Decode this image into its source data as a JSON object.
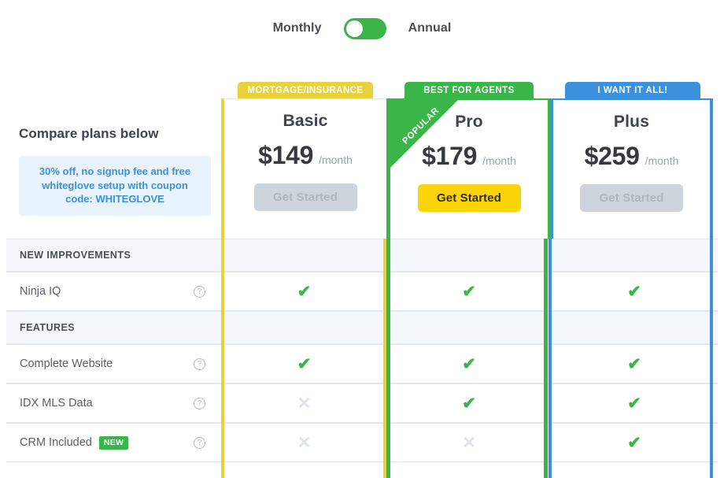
{
  "billing": {
    "monthly_label": "Monthly",
    "annual_label": "Annual",
    "selected": "Monthly",
    "toggle_color": "#3ab54a"
  },
  "intro": {
    "title": "Compare plans below",
    "coupon_text": "30% off, no signup fee and free whiteglove setup with coupon code: WHITEGLOVE",
    "coupon_bg": "#e8f3fd",
    "coupon_color": "#3b91dc"
  },
  "plans": [
    {
      "id": "basic",
      "banner": "MORTGAGE/INSURANCE",
      "banner_color": "#e8d13a",
      "accent": "#e8d13a",
      "name": "Basic",
      "price": "$149",
      "period": "/month",
      "cta_label": "Get Started",
      "cta_state": "disabled",
      "ribbon": null
    },
    {
      "id": "pro",
      "banner": "BEST FOR AGENTS",
      "banner_color": "#3ab54a",
      "accent": "#3ab54a",
      "name": "Pro",
      "price": "$179",
      "period": "/month",
      "cta_label": "Get Started",
      "cta_state": "active",
      "ribbon": "POPULAR"
    },
    {
      "id": "plus",
      "banner": "I WANT IT ALL!",
      "banner_color": "#3b91dc",
      "accent": "#3b91dc",
      "name": "Plus",
      "price": "$259",
      "period": "/month",
      "cta_label": "Get Started",
      "cta_state": "disabled",
      "ribbon": null
    }
  ],
  "table": {
    "help_icon": "help-circle-icon",
    "yes_glyph": "✔",
    "no_glyph": "✕",
    "yes_color": "#3ab54a",
    "no_color": "#dde3ea",
    "rows": [
      {
        "kind": "section",
        "label": "NEW IMPROVEMENTS"
      },
      {
        "kind": "feature",
        "label": "Ninja IQ",
        "badge": null,
        "basic": "yes",
        "pro": "yes",
        "plus": "yes"
      },
      {
        "kind": "section",
        "label": "FEATURES"
      },
      {
        "kind": "feature",
        "label": "Complete Website",
        "badge": null,
        "basic": "yes",
        "pro": "yes",
        "plus": "yes"
      },
      {
        "kind": "feature",
        "label": "IDX MLS Data",
        "badge": null,
        "basic": "no",
        "pro": "yes",
        "plus": "yes"
      },
      {
        "kind": "feature",
        "label": "CRM Included",
        "badge": "NEW",
        "basic": "no",
        "pro": "no",
        "plus": "yes"
      }
    ]
  }
}
